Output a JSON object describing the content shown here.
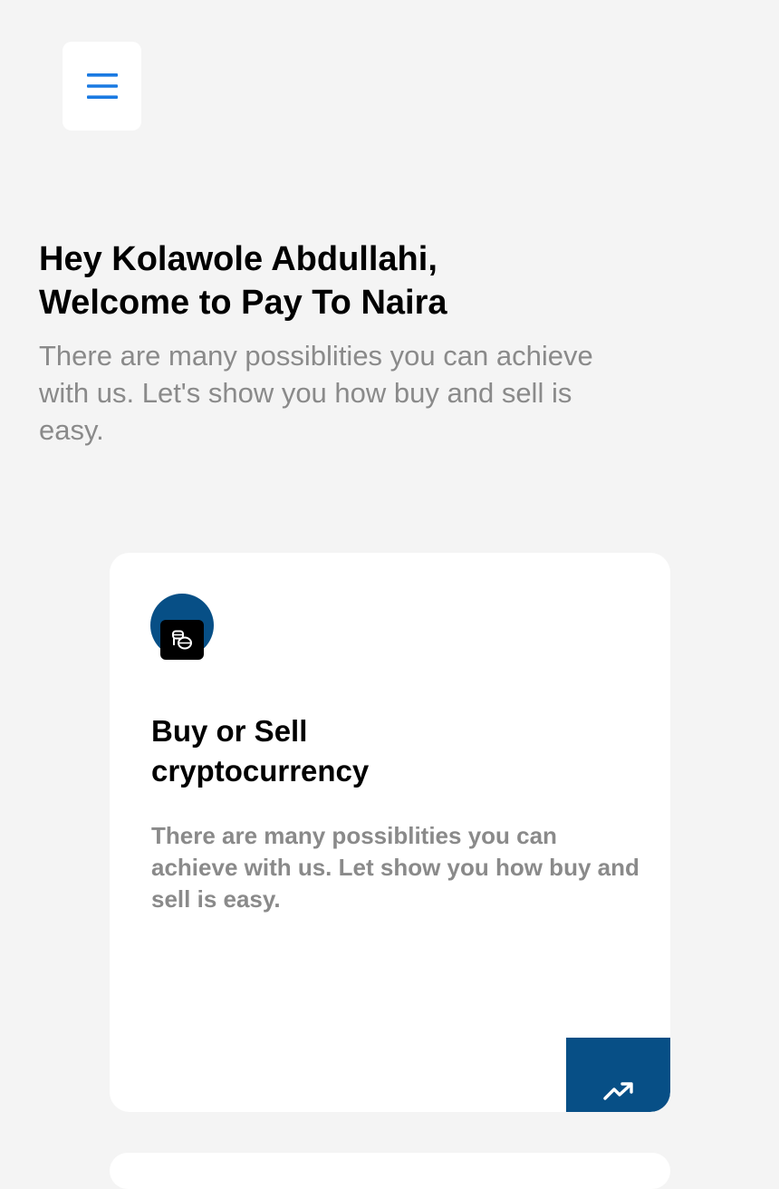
{
  "header": {
    "menu_icon": "hamburger-menu-icon",
    "menu_icon_color": "#1a7ae2"
  },
  "greeting": {
    "line1": "Hey Kolawole Abdullahi,",
    "line2": "Welcome to Pay To Naira"
  },
  "intro": "There are many possiblities you can achieve with us. Let's show you how buy and sell is easy.",
  "card": {
    "icon": "coins-icon",
    "icon_bg_color": "#074f86",
    "title_line1": "Buy or Sell",
    "title_line2": "cryptocurrency",
    "description": "There are many possiblities you can achieve with us. Let show you how buy and sell is easy.",
    "action_icon": "trending-up-icon",
    "action_bg_color": "#074f86"
  }
}
